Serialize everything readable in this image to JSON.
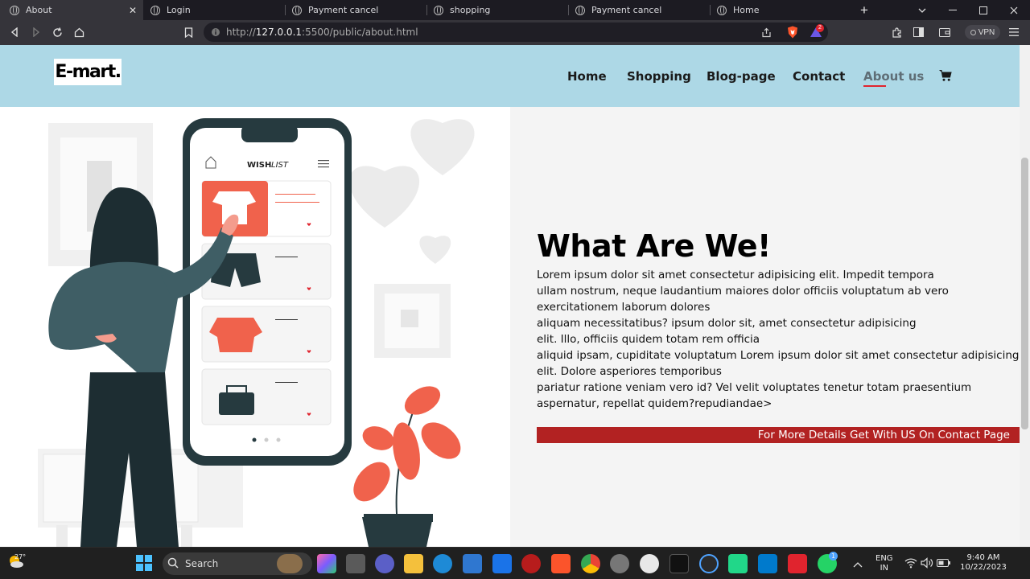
{
  "browser": {
    "tabs": [
      {
        "title": "About",
        "active": true
      },
      {
        "title": "Login"
      },
      {
        "title": "Payment cancel"
      },
      {
        "title": "shopping"
      },
      {
        "title": "Payment cancel"
      },
      {
        "title": "Home"
      }
    ],
    "url_prefix": "http://",
    "url_host": "127.0.0.1",
    "url_rest": ":5500/public/about.html",
    "vpn_label": "VPN",
    "shield_badge": "2"
  },
  "site": {
    "logo": "E-mart.",
    "nav": [
      {
        "label": "Home"
      },
      {
        "label": "Shopping"
      },
      {
        "label": "Blog-page"
      },
      {
        "label": "Contact"
      },
      {
        "label": "About us",
        "active": true
      }
    ],
    "accent_color": "#b22222",
    "navbar_color": "#add8e6"
  },
  "illustration": {
    "wishlist_bold": "WISH",
    "wishlist_italic": "LIST"
  },
  "about": {
    "heading": "What Are We!",
    "lines": [
      "Lorem ipsum dolor sit amet consectetur adipisicing elit. Impedit tempora",
      "ullam nostrum, neque laudantium maiores dolor officiis voluptatum ab vero",
      "exercitationem laborum dolores",
      "aliquam necessitatibus? ipsum dolor sit, amet consectetur adipisicing",
      "elit. Illo, officiis quidem totam rem officia",
      "aliquid ipsam, cupiditate voluptatum Lorem ipsum dolor sit amet consectetur adipisicing",
      "elit. Dolore asperiores temporibus",
      "pariatur ratione veniam vero id? Vel velit voluptates tenetur totam praesentium",
      "aspernatur, repellat quidem?repudiandae>"
    ],
    "cta": "For More Details Get With US On Contact Page"
  },
  "taskbar": {
    "weather": "27°",
    "search_label": "Search",
    "lang_top": "ENG",
    "lang_bottom": "IN",
    "time": "9:40 AM",
    "date": "10/22/2023",
    "whatsapp_badge": "1"
  }
}
